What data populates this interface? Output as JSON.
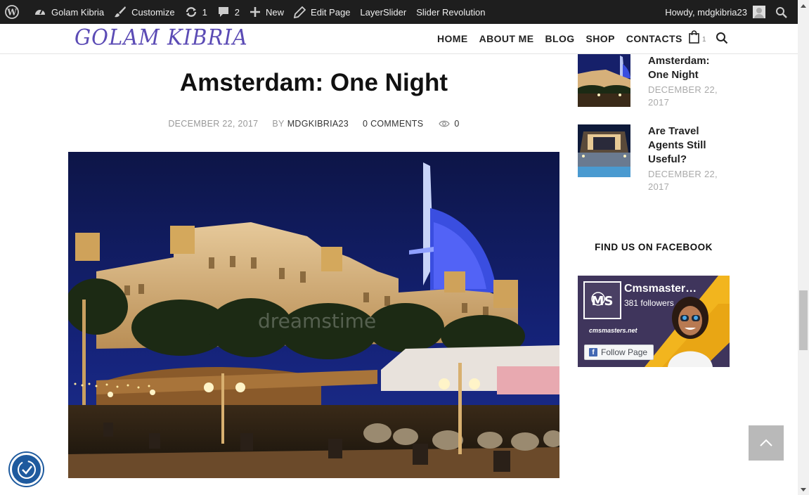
{
  "adminbar": {
    "site_name": "Golam Kibria",
    "customize": "Customize",
    "updates_count": "1",
    "comments_count": "2",
    "new_label": "New",
    "edit_page": "Edit Page",
    "layerslider": "LayerSlider",
    "slider_revolution": "Slider Revolution",
    "howdy": "Howdy, mdgkibria23"
  },
  "header": {
    "logo_text": "GOLAM KIBRIA",
    "nav": [
      "HOME",
      "ABOUT ME",
      "BLOG",
      "SHOP",
      "CONTACTS"
    ],
    "cart_count": "1"
  },
  "post": {
    "title": "Amsterdam: One Night",
    "date": "DECEMBER 22, 2017",
    "by": "BY",
    "author": "MDGKIBRIA23",
    "comments": "0 COMMENTS",
    "views": "0",
    "image_watermark": "dreamstime"
  },
  "sidebar": {
    "recent_posts": [
      {
        "title": "Amsterdam: One Night",
        "date": "DECEMBER 22, 2017"
      },
      {
        "title": "Are Travel Agents Still Useful?",
        "date": "DECEMBER 22, 2017"
      }
    ],
    "facebook_heading": "FIND US ON FACEBOOK",
    "facebook": {
      "page_name": "Cmsmaster…",
      "followers": "381 followers",
      "site": "cmsmasters.net",
      "follow_button": "Follow Page"
    }
  },
  "colors": {
    "adminbar_bg": "#1e1e1e",
    "logo": "#5b4bb5",
    "backtotop_bg": "#b9b9b9",
    "a11y_bg": "#1e5a9e"
  }
}
